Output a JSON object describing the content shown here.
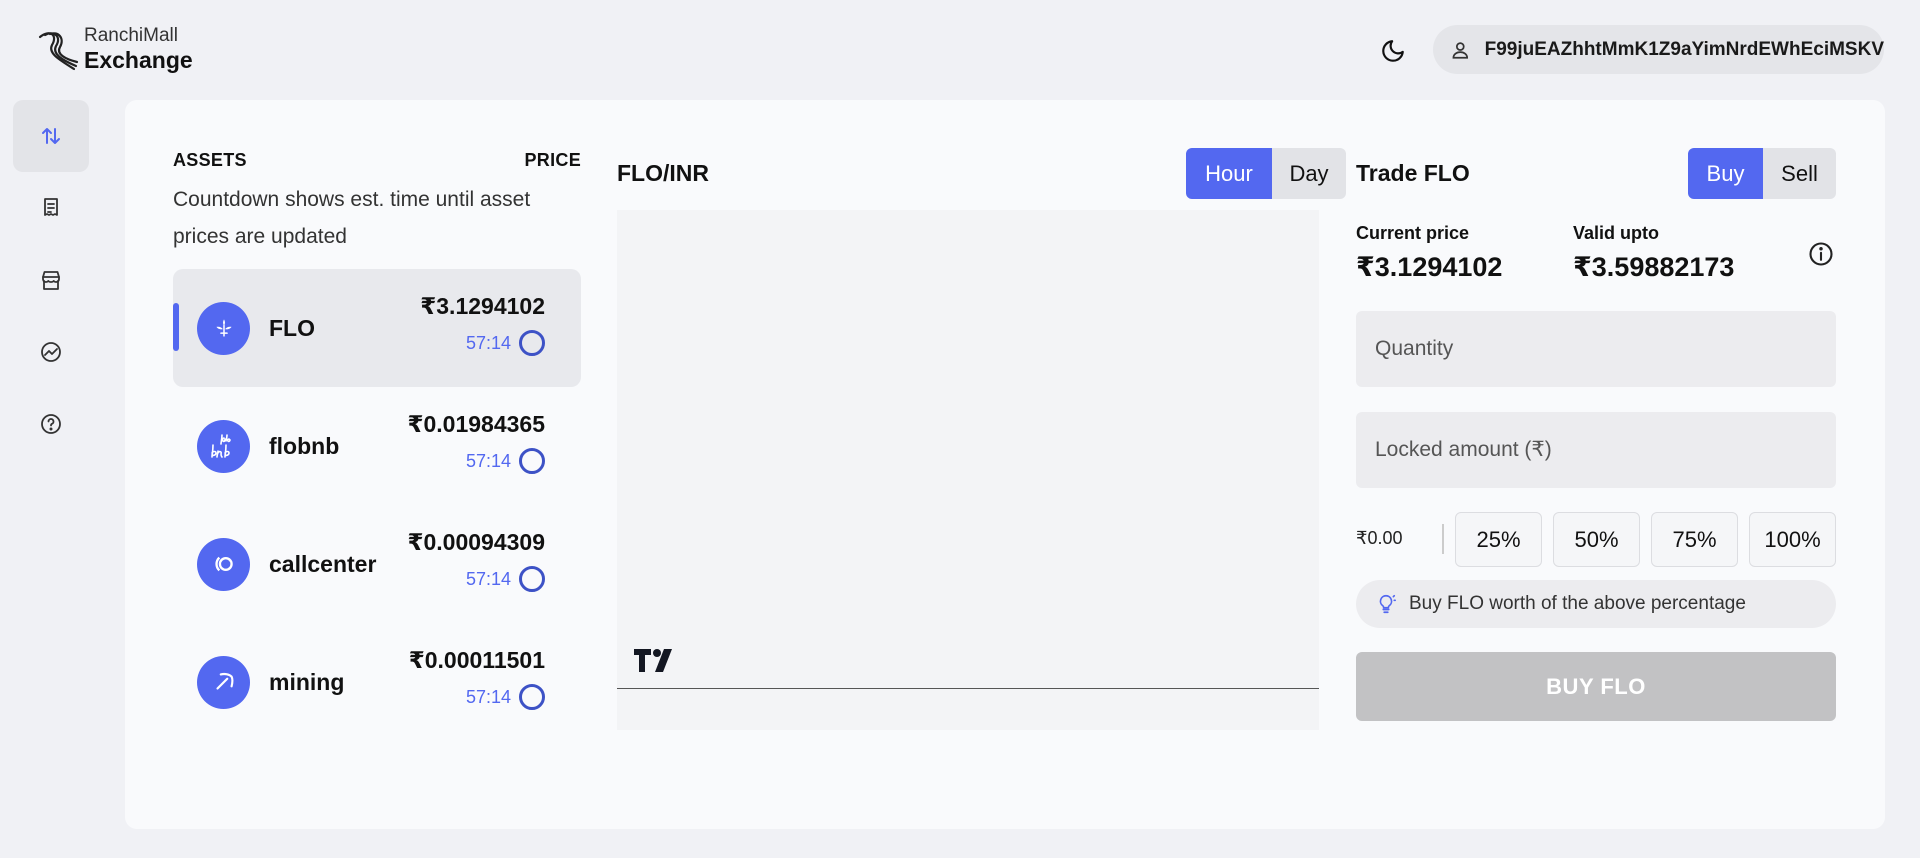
{
  "brand": {
    "small": "RanchiMall",
    "big": "Exchange"
  },
  "header": {
    "user_id": "F99juEAZhhtMmK1Z9aYimNrdEWhEciMSKV",
    "theme_icon": "moon-icon",
    "user_icon": "user-icon"
  },
  "sidebar": {
    "items": [
      {
        "name": "trade",
        "icon": "arrows-up-down-icon",
        "active": true
      },
      {
        "name": "orders",
        "icon": "receipt-icon",
        "active": false
      },
      {
        "name": "market",
        "icon": "store-icon",
        "active": false
      },
      {
        "name": "portfolio",
        "icon": "chart-icon",
        "active": false
      },
      {
        "name": "help",
        "icon": "question-icon",
        "active": false
      }
    ]
  },
  "assets": {
    "header_left": "ASSETS",
    "header_right": "PRICE",
    "subtitle": "Countdown shows est. time until asset prices are updated",
    "items": [
      {
        "name": "FLO",
        "price": "₹3.1294102",
        "timer": "57:14",
        "icon": "flo-icon",
        "active": true
      },
      {
        "name": "flobnb",
        "price": "₹0.01984365",
        "timer": "57:14",
        "icon": "flobnb-icon",
        "active": false
      },
      {
        "name": "callcenter",
        "price": "₹0.00094309",
        "timer": "57:14",
        "icon": "callcenter-icon",
        "active": false
      },
      {
        "name": "mining",
        "price": "₹0.00011501",
        "timer": "57:14",
        "icon": "pickaxe-icon",
        "active": false
      }
    ]
  },
  "chart": {
    "pair": "FLO/INR",
    "ranges": [
      "Hour",
      "Day"
    ],
    "selected_range": "Hour",
    "logo_icon": "tradingview-logo-icon"
  },
  "trade": {
    "title": "Trade FLO",
    "modes": [
      "Buy",
      "Sell"
    ],
    "selected_mode": "Buy",
    "current_price_label": "Current price",
    "current_price": "₹3.1294102",
    "valid_upto_label": "Valid upto",
    "valid_upto": "₹3.59882173",
    "quantity_placeholder": "Quantity",
    "locked_placeholder": "Locked amount (₹)",
    "balance": "₹0.00",
    "percentages": [
      "25%",
      "50%",
      "75%",
      "100%"
    ],
    "hint": "Buy FLO worth of the above percentage",
    "submit": "BUY FLO"
  },
  "colors": {
    "accent": "#5368f0",
    "background": "#f0f1f5",
    "card": "#f9fafc",
    "disabled": "#c2c2c4"
  }
}
